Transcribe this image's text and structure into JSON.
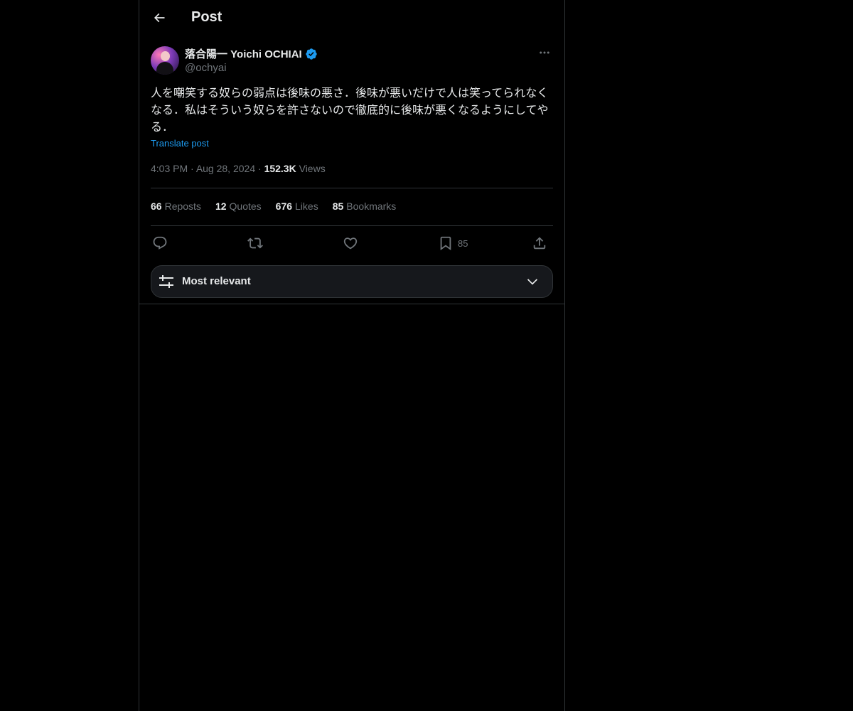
{
  "header": {
    "title": "Post",
    "back_icon": "arrow-left-icon"
  },
  "author": {
    "display_name": "落合陽一 Yoichi OCHIAI",
    "handle": "@ochyai",
    "verified": true,
    "verified_color": "#1d9bf0"
  },
  "tweet": {
    "text": "人を嘲笑する奴らの弱点は後味の悪さ．後味が悪いだけで人は笑ってられなくなる．私はそういう奴らを許さないので徹底的に後味が悪くなるようにしてやる．",
    "translate_label": "Translate post",
    "time": "4:03 PM",
    "date": "Aug 28, 2024",
    "views_count": "152.3K",
    "views_label": "Views"
  },
  "stats": {
    "reposts": {
      "count": "66",
      "label": "Reposts"
    },
    "quotes": {
      "count": "12",
      "label": "Quotes"
    },
    "likes": {
      "count": "676",
      "label": "Likes"
    },
    "bookmarks": {
      "count": "85",
      "label": "Bookmarks"
    }
  },
  "actions": {
    "reply_icon": "reply-icon",
    "repost_icon": "repost-icon",
    "like_icon": "heart-icon",
    "bookmark_icon": "bookmark-icon",
    "bookmark_count": "85",
    "share_icon": "share-icon"
  },
  "sort": {
    "label": "Most relevant",
    "icon": "sliders-icon",
    "chevron": "chevron-down-icon"
  },
  "colors": {
    "background": "#000000",
    "text": "#e7e9ea",
    "muted": "#71767b",
    "accent": "#1d9bf0",
    "border": "#2f3336"
  }
}
